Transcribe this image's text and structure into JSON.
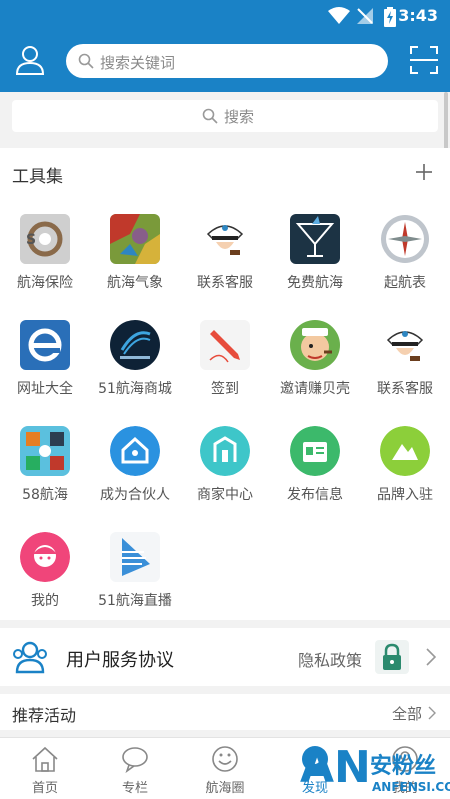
{
  "status_bar": {
    "time": "3:43"
  },
  "header": {
    "search_placeholder": "搜索关键词"
  },
  "sub_search": {
    "placeholder": "搜索"
  },
  "tools": {
    "title": "工具集",
    "items": [
      {
        "label": "航海保险",
        "icon": "insurance-icon"
      },
      {
        "label": "航海气象",
        "icon": "weather-map-icon"
      },
      {
        "label": "联系客服",
        "icon": "captain-icon"
      },
      {
        "label": "免费航海",
        "icon": "cocktail-icon"
      },
      {
        "label": "起航表",
        "icon": "compass-icon"
      },
      {
        "label": "网址大全",
        "icon": "ie-icon"
      },
      {
        "label": "51航海商城",
        "icon": "mall-icon"
      },
      {
        "label": "签到",
        "icon": "pencil-icon"
      },
      {
        "label": "邀请赚贝壳",
        "icon": "popeye-icon"
      },
      {
        "label": "联系客服",
        "icon": "captain-icon"
      },
      {
        "label": "58航海",
        "icon": "puzzle-icon"
      },
      {
        "label": "成为合伙人",
        "icon": "house-icon"
      },
      {
        "label": "商家中心",
        "icon": "shop-icon"
      },
      {
        "label": "发布信息",
        "icon": "id-card-icon"
      },
      {
        "label": "品牌入驻",
        "icon": "mountain-icon"
      },
      {
        "label": "我的",
        "icon": "avatar-icon"
      },
      {
        "label": "51航海直播",
        "icon": "live-icon"
      }
    ]
  },
  "agreement": {
    "user_agreement": "用户服务协议",
    "privacy": "隐私政策"
  },
  "recommend": {
    "title": "推荐活动",
    "all": "全部"
  },
  "tabbar": {
    "tabs": [
      "首页",
      "专栏",
      "航海圈",
      "发现",
      "我的"
    ]
  },
  "watermark": {
    "big": "AN",
    "cn": "安粉丝",
    "en": "ANFENSI.COM"
  },
  "colors": {
    "brand": "#1a82c6",
    "background": "#f2f2f2"
  }
}
